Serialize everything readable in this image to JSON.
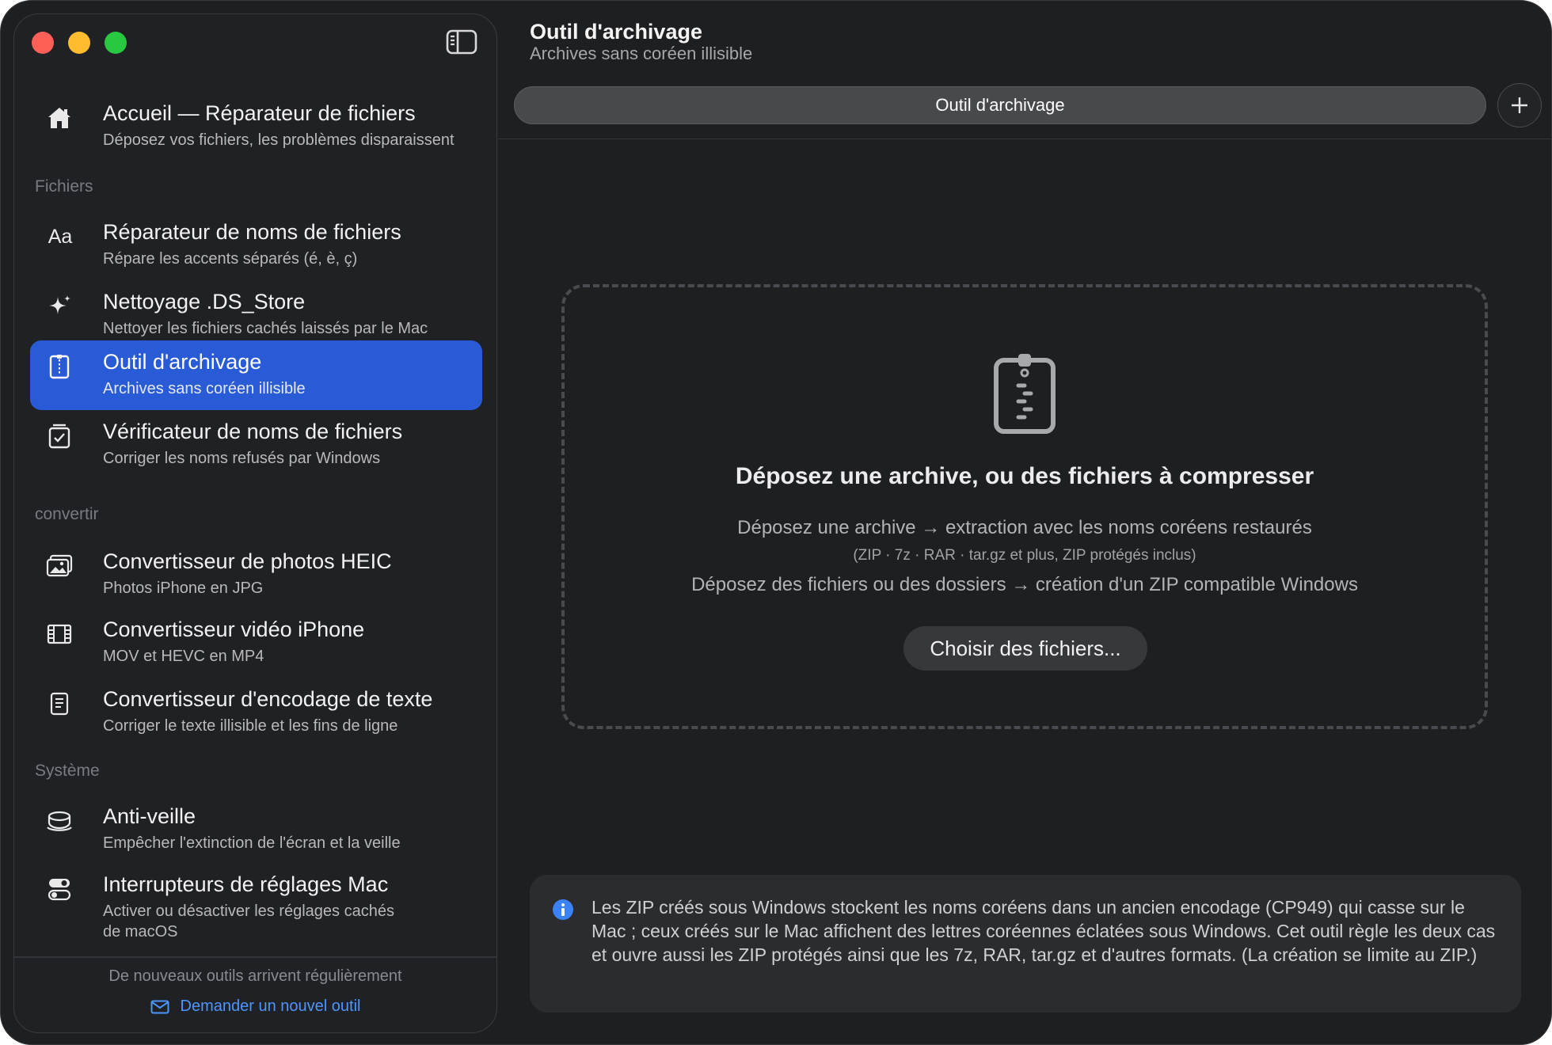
{
  "sidebar": {
    "home": {
      "title": "Accueil — Réparateur de fichiers",
      "subtitle": "Déposez vos fichiers, les problèmes disparaissent",
      "icon": "house-icon"
    },
    "sections": [
      {
        "label": "Fichiers",
        "items": [
          {
            "title": "Réparateur de noms de fichiers",
            "subtitle": "Répare les accents séparés (é, è, ç)",
            "icon": "Aa"
          },
          {
            "title": "Nettoyage .DS_Store",
            "subtitle": "Nettoyer les fichiers cachés laissés par le Mac",
            "icon": "sparkles-icon"
          },
          {
            "title": "Outil d'archivage",
            "subtitle": "Archives sans coréen illisible",
            "icon": "zip-archive-icon",
            "active": true
          },
          {
            "title": "Vérificateur de noms de fichiers",
            "subtitle": "Corriger les noms refusés par Windows",
            "icon": "checklist-icon"
          }
        ]
      },
      {
        "label": "convertir",
        "items": [
          {
            "title": "Convertisseur de photos HEIC",
            "subtitle": "Photos iPhone en JPG",
            "icon": "photos-icon"
          },
          {
            "title": "Convertisseur vidéo iPhone",
            "subtitle": "MOV et HEVC en MP4",
            "icon": "film-icon"
          },
          {
            "title": "Convertisseur d'encodage de texte",
            "subtitle": "Corriger le texte illisible et les fins de ligne",
            "icon": "document-icon"
          }
        ]
      },
      {
        "label": "Système",
        "items": [
          {
            "title": "Anti-veille",
            "subtitle": "Empêcher l'extinction de l'écran et la veille",
            "icon": "coffee-cup-icon"
          },
          {
            "title": "Interrupteurs de réglages Mac",
            "subtitle": "Activer ou désactiver les réglages cachés",
            "subtitle2": "de macOS",
            "icon": "toggles-icon"
          }
        ]
      }
    ],
    "footer": {
      "note": "De nouveaux outils arrivent régulièrement",
      "link": "Demander un nouvel outil"
    }
  },
  "main": {
    "title": "Outil d'archivage",
    "subtitle": "Archives sans coréen illisible",
    "tab_label": "Outil d'archivage",
    "add_tab_icon": "plus-icon",
    "dropzone": {
      "title": "Déposez une archive, ou des fichiers à compresser",
      "line1": "Déposez une archive → extraction avec les noms coréens restaurés",
      "line2": "(ZIP · 7z · RAR · tar.gz et plus, ZIP protégés inclus)",
      "line3": "Déposez des fichiers ou des dossiers → création d'un ZIP compatible Windows",
      "button": "Choisir des fichiers..."
    },
    "info": "Les ZIP créés sous Windows stockent les noms coréens dans un ancien encodage (CP949) qui casse sur le Mac ; ceux créés sur le Mac affichent des lettres coréennes éclatées sous Windows. Cet outil règle les deux cas et ouvre aussi les ZIP protégés ainsi que les 7z, RAR, tar.gz et d'autres formats. (La création se limite au ZIP.)"
  },
  "colors": {
    "accent": "#2a5bd7",
    "link": "#4d95ff",
    "info_icon": "#3b82f6"
  }
}
